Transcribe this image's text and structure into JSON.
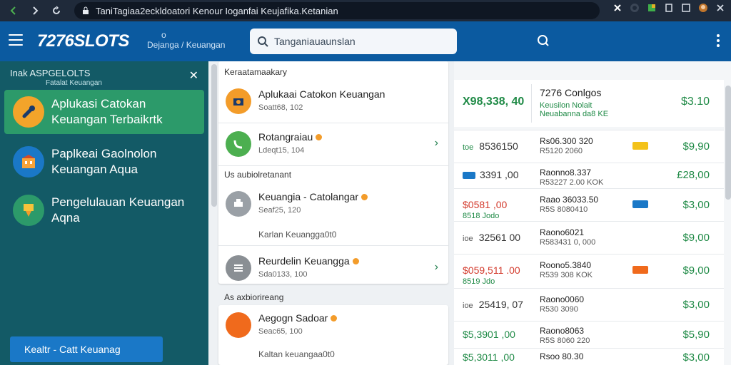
{
  "browser": {
    "url": "TaniTagiaa2eckldoatori Kenour Ioganfai Keujafika.Ketanian",
    "icons": [
      "back-icon",
      "forward-icon",
      "reload-icon",
      "lock-icon",
      "extension-icon",
      "profile-icon",
      "menu-icon",
      "close-icon"
    ]
  },
  "header": {
    "logo": "7276SLOTS",
    "sublogo_line1": "o",
    "sublogo_line2": "Dejanga / Keuangan",
    "search_placeholder": "Tanganiauaunslan"
  },
  "sidebar": {
    "title": "Inak ASPGELOLTS",
    "subtitle": "Fatalat Keuangan",
    "items": [
      {
        "label": "Aplukasi Catokan Keuangan Terbaikrtk",
        "active": true
      },
      {
        "label": "Paplkeai Gaolnolon Keuangan Aqua",
        "active": false
      },
      {
        "label": "Pengelulauan Keuangan Aqna",
        "active": false
      }
    ],
    "footer_button": "Kealtr - Catt Keuanag"
  },
  "middle": {
    "section1": "Keraatamaakary",
    "section2": "Us aubiolretanant",
    "section3": "As axbiorireang",
    "rows": [
      {
        "title": "Aplukaai Catokon Keuangan",
        "sub": "Soatt68, 102",
        "color": "#f39c2a"
      },
      {
        "title": "Rotangraiau",
        "sub": "Ldeqt15, 104",
        "color": "#4caf50"
      },
      {
        "title": "Keuangia - Catolangar",
        "sub": "Seaf25, 120",
        "color": "#9aa0a6"
      },
      {
        "title": "Reurdelin Keuangga",
        "sub": "Sda0133, 100",
        "color": "#8a8f94"
      },
      {
        "title": "Aegogn Sadoar",
        "sub": "Seac65, 100",
        "color": "#f06a1c"
      }
    ],
    "note1": "Karlan Keuangga0t0",
    "note2": "Kaltan keuangaa0t0"
  },
  "right": {
    "top": {
      "big": "X98,338, 40",
      "heading": "7276 Conlgos",
      "sub1": "Keusilon Nolait",
      "sub2": "Neuabanna  da8 KE",
      "amount": "$3.10"
    },
    "rows": [
      {
        "c1": "8536150",
        "c1_prefix": "toe",
        "c1_class": "",
        "c2a": "Rs06.300 320",
        "c2b": "R5120 2060",
        "badge": "#f3c21a",
        "amount": "$9,90"
      },
      {
        "c1": "3391 ,00",
        "c1_prefix": "",
        "c1_class": "",
        "c2a": "Raonno8.337",
        "c2b": "R53227 2.00 KOK",
        "badge": "",
        "amount": "£28,00"
      },
      {
        "c1": "$0581 ,00",
        "c1_prefix": "",
        "c1_class": "red",
        "c1sub": "8518 Jodo",
        "c2a": "Raao 36033.50",
        "c2b": "R5S 8080410",
        "badge": "#1a78c7",
        "amount": "$3,00"
      },
      {
        "c1": "32561 00",
        "c1_prefix": "ioe",
        "c1_class": "",
        "c2a": "Raono6021",
        "c2b": "R583431 0, 000",
        "badge": "",
        "amount": "$9,00"
      },
      {
        "c1": "$059,511 .00",
        "c1_prefix": "",
        "c1_class": "red",
        "c1sub": "8519 Jdo",
        "c2a": "Roono5.3840",
        "c2b": "R539 308  KOK",
        "badge": "#f06a1c",
        "amount": "$9,00"
      },
      {
        "c1": "25419, 07",
        "c1_prefix": "ioe",
        "c1_class": "",
        "c2a": "Raono0060",
        "c2b": "R530 3090",
        "badge": "",
        "amount": "$3,00"
      },
      {
        "c1": "$5,3901 ,00",
        "c1_prefix": "",
        "c1_class": "green",
        "c2a": "Raono8063",
        "c2b": "R5S 8060 220",
        "badge": "",
        "amount": "$5,90"
      },
      {
        "c1": "$5,3011 ,00",
        "c1_prefix": "",
        "c1_class": "green",
        "c2a": "Rsoo 80.30",
        "c2b": "",
        "badge": "",
        "amount": "$3,00"
      }
    ]
  }
}
